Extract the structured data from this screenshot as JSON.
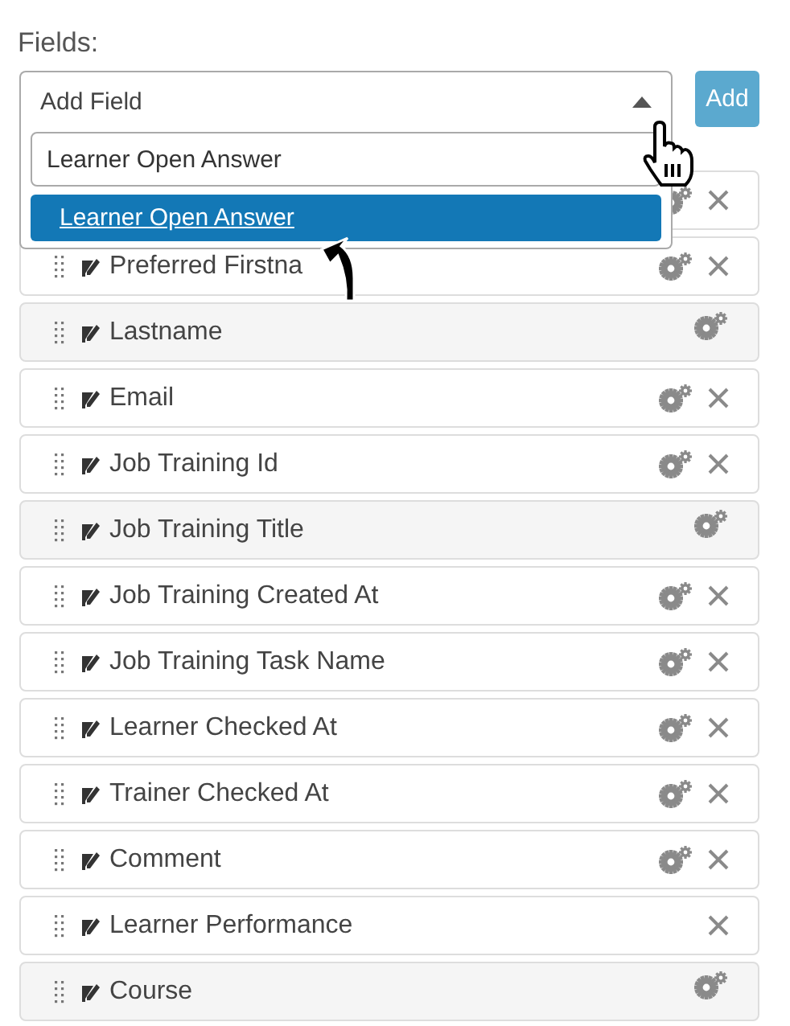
{
  "heading": "Fields:",
  "field_select": {
    "value": "Add Field",
    "expanded": true,
    "search": {
      "value": "Learner Open Answer"
    },
    "options": [
      {
        "label": "Learner Open Answer",
        "selected": true
      }
    ]
  },
  "add_button": "Add",
  "fields": [
    {
      "locked": false,
      "settings": true,
      "removable": true
    },
    {
      "label": "Preferred Firstna",
      "locked": false,
      "settings": true,
      "removable": true
    },
    {
      "label": "Lastname",
      "locked": true,
      "settings": true,
      "removable": false
    },
    {
      "label": "Email",
      "locked": false,
      "settings": true,
      "removable": true
    },
    {
      "label": "Job Training Id",
      "locked": false,
      "settings": true,
      "removable": true
    },
    {
      "label": "Job Training Title",
      "locked": true,
      "settings": true,
      "removable": false
    },
    {
      "label": "Job Training Created At",
      "locked": false,
      "settings": true,
      "removable": true
    },
    {
      "label": "Job Training Task Name",
      "locked": false,
      "settings": true,
      "removable": true
    },
    {
      "label": "Learner Checked At",
      "locked": false,
      "settings": true,
      "removable": true
    },
    {
      "label": "Trainer Checked At",
      "locked": false,
      "settings": true,
      "removable": true
    },
    {
      "label": "Comment",
      "locked": false,
      "settings": true,
      "removable": true
    },
    {
      "label": "Learner Performance",
      "locked": false,
      "settings": false,
      "removable": true
    },
    {
      "label": "Course",
      "locked": true,
      "settings": true,
      "removable": false
    }
  ]
}
